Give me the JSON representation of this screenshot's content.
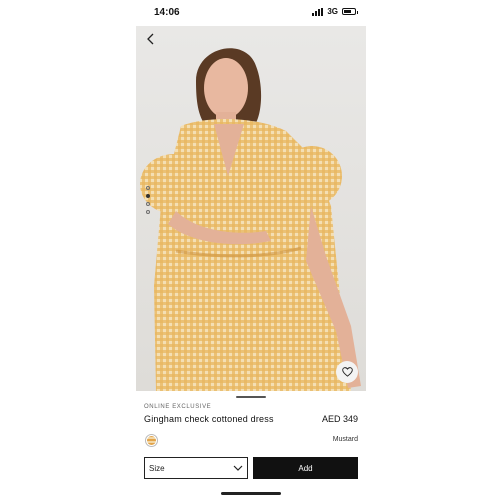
{
  "status_bar": {
    "time": "14:06",
    "network": "3G",
    "battery_fill": 0.7
  },
  "gallery": {
    "total_dots": 4,
    "active_dot": 1
  },
  "product": {
    "badge": "ONLINE EXCLUSIVE",
    "name": "Gingham check cottoned dress",
    "price": "AED 349",
    "color_name": "Mustard"
  },
  "actions": {
    "size_label": "Size",
    "add_label": "Add"
  },
  "icons": {
    "back": "chevron-left-icon",
    "wishlist": "heart-icon",
    "dropdown": "chevron-down-icon"
  },
  "colors": {
    "dress_mustard": "#e2a44a",
    "button_dark": "#111111"
  }
}
